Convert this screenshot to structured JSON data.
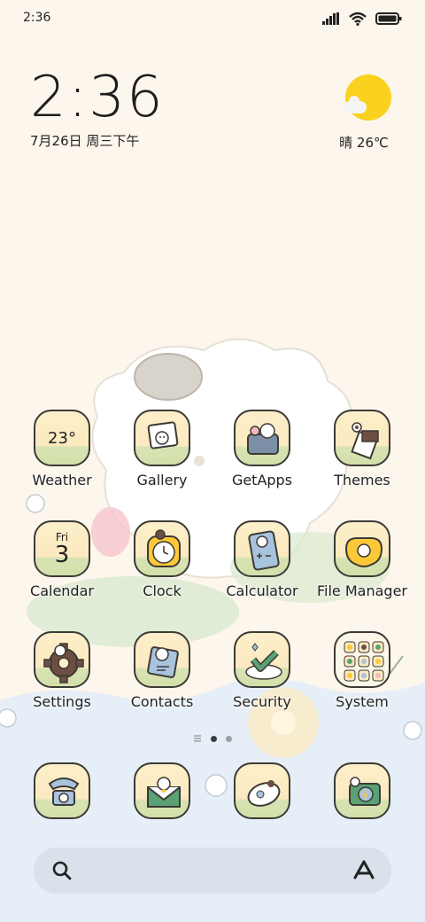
{
  "status_bar": {
    "time": "2:36",
    "icons": [
      "signal-icon",
      "wifi-icon",
      "battery-icon"
    ]
  },
  "clock_widget": {
    "time": "2:36",
    "date": "7月26日 周三下午"
  },
  "weather_widget": {
    "condition_temp": "晴 26℃",
    "icon": "sun-cloud-icon"
  },
  "apps": {
    "weather": {
      "label": "Weather",
      "temp": "23°"
    },
    "gallery": {
      "label": "Gallery"
    },
    "getapps": {
      "label": "GetApps"
    },
    "themes": {
      "label": "Themes"
    },
    "calendar": {
      "label": "Calendar",
      "day": "Fri",
      "date": "3"
    },
    "clock": {
      "label": "Clock"
    },
    "calculator": {
      "label": "Calculator"
    },
    "file_manager": {
      "label": "File Manager"
    },
    "settings": {
      "label": "Settings"
    },
    "contacts": {
      "label": "Contacts"
    },
    "security": {
      "label": "Security"
    },
    "system": {
      "label": "System"
    }
  },
  "dock": [
    "phone",
    "messages",
    "browser",
    "camera"
  ],
  "page_indicator": {
    "pages": 2,
    "current": 1
  },
  "search_bar": {
    "icon": "search-icon",
    "assistant_icon": "assistant-icon"
  },
  "colors": {
    "background": "#fdf6ec",
    "icon_tile": "#fcefc9",
    "icon_outline": "#3c3a36",
    "sun": "#fbd11f"
  }
}
